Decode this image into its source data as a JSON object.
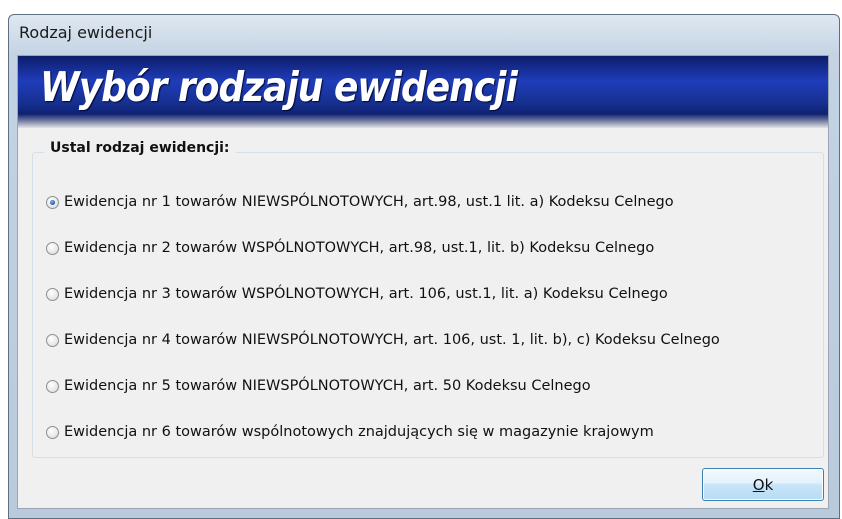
{
  "window": {
    "title": "Rodzaj ewidencji"
  },
  "banner": {
    "title": "Wybór rodzaju ewidencji"
  },
  "group": {
    "legend": "Ustal rodzaj ewidencji:",
    "options": [
      {
        "label": "Ewidencja nr 1 towarów NIEWSPÓLNOTOWYCH, art.98, ust.1 lit. a) Kodeksu Celnego",
        "checked": true
      },
      {
        "label": "Ewidencja nr 2 towarów WSPÓLNOTOWYCH, art.98, ust.1, lit. b) Kodeksu Celnego",
        "checked": false
      },
      {
        "label": "Ewidencja nr 3 towarów WSPÓLNOTOWYCH, art. 106, ust.1, lit. a) Kodeksu Celnego",
        "checked": false
      },
      {
        "label": "Ewidencja nr 4 towarów NIEWSPÓLNOTOWYCH, art. 106, ust. 1, lit. b), c) Kodeksu Celnego",
        "checked": false
      },
      {
        "label": "Ewidencja nr 5 towarów NIEWSPÓLNOTOWYCH, art. 50 Kodeksu Celnego",
        "checked": false
      },
      {
        "label": "Ewidencja nr 6 towarów wspólnotowych znajdujących się w magazynie krajowym",
        "checked": false
      }
    ]
  },
  "buttons": {
    "ok_mnemonic": "O",
    "ok_rest": "k"
  },
  "colors": {
    "banner_dark": "#0d1d6b",
    "banner_mid": "#1f3dbb",
    "button_border": "#3c7fb1",
    "radio_dot": "#2a5fb0"
  }
}
